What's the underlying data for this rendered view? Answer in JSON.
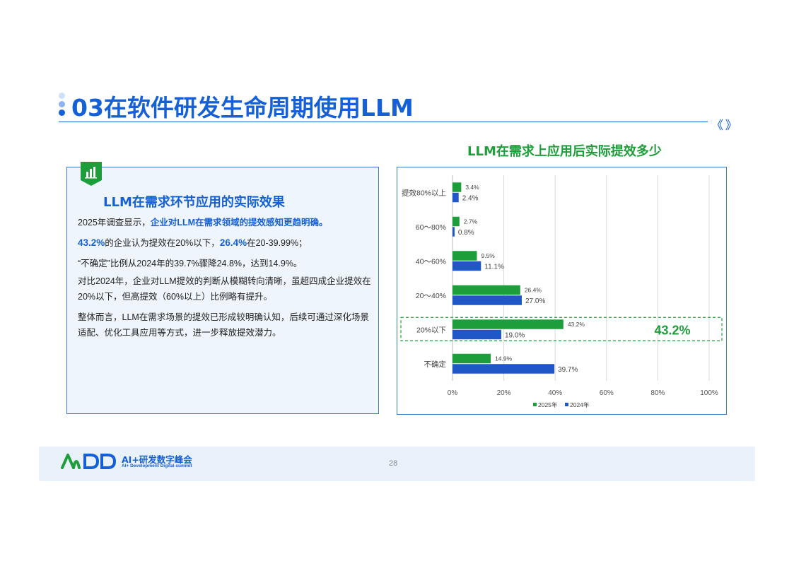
{
  "header": {
    "title": "03在软件研发生命周期使用LLM",
    "chevron": "《 》"
  },
  "left_panel": {
    "heading": "LLM在需求环节应用的实际效果",
    "p1_prefix": "2025年调查显示，",
    "p1_highlight": "企业对LLM在需求领域的提效感知更趋明确。",
    "p2_v1": "43.2%",
    "p2_t1": "的企业认为提效在20%以下，",
    "p2_v2": "26.4%",
    "p2_t2": "在20-39.99%；",
    "p3": "“不确定”比例从2024年的39.7%骤降24.8%，达到14.9%。",
    "p4_line1": "对比2024年，企业对LLM提效的判断从模糊转向清晰，虽超四成企业提效在",
    "p4_line2": "20%以下，但高提效（60%以上）比例略有提升。",
    "p5_line1": "整体而言，LLM在需求场景的提效已形成较明确认知，后续可通过深化场景",
    "p5_line2": "适配、优化工具应用等方式，进一步释放提效潜力。"
  },
  "chart_title": "LLM在需求上应用后实际提效多少",
  "chart_data": {
    "type": "bar",
    "orientation": "horizontal",
    "title": "LLM在需求上应用后实际提效多少",
    "categories": [
      "提效80%以上",
      "60～80%",
      "40～60%",
      "20～40%",
      "20%以下",
      "不确定"
    ],
    "series": [
      {
        "name": "2025年",
        "values": [
          3.4,
          2.7,
          9.5,
          26.4,
          43.2,
          14.9
        ],
        "color": "#1e9e3a"
      },
      {
        "name": "2024年",
        "values": [
          2.4,
          0.8,
          11.1,
          27.0,
          19.0,
          39.7
        ],
        "color": "#1f57c7"
      }
    ],
    "xlim": [
      0,
      100
    ],
    "x_ticks": [
      "0%",
      "20%",
      "40%",
      "60%",
      "80%",
      "100%"
    ],
    "grid": true,
    "legend": "bottom",
    "annotation": {
      "category": "20%以下",
      "text": "43.2%",
      "color": "#1e9e3a"
    }
  },
  "footer": {
    "brand_logo": "AiDD",
    "brand_name": "AI+研发数字峰会",
    "brand_sub": "AI+ Development Digital summit",
    "page_number": "28"
  },
  "colors": {
    "primary_blue": "#1560d6",
    "green": "#1e9e3a",
    "bar_blue": "#1f57c7"
  }
}
